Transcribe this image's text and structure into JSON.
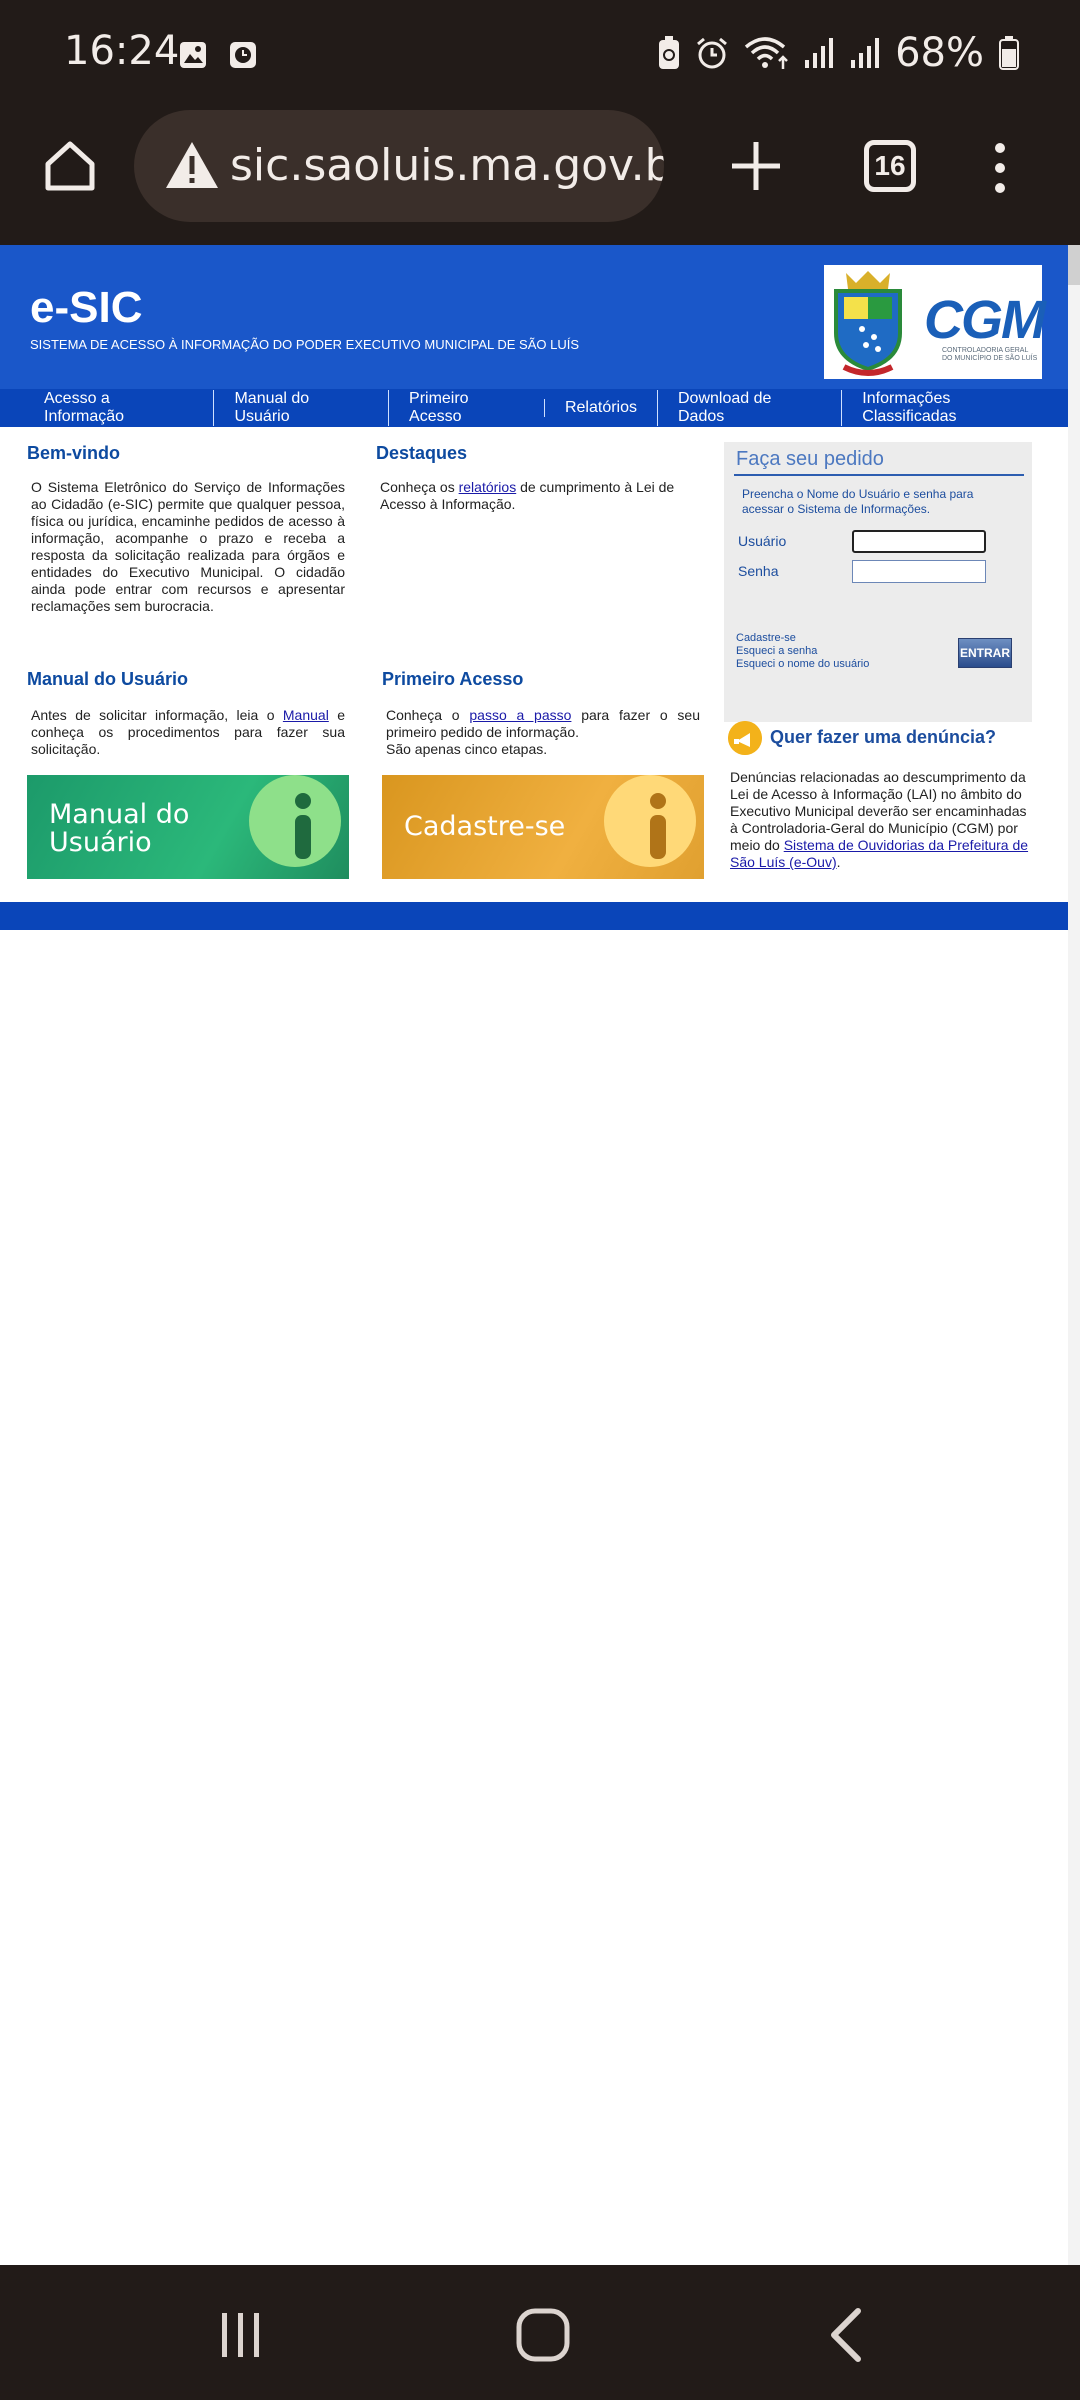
{
  "status_bar": {
    "time": "16:24",
    "battery": "68%",
    "left_icons": [
      "image-icon",
      "clock-app-icon"
    ],
    "right_icons": [
      "battery-saver-icon",
      "alarm-icon",
      "wifi-icon",
      "signal-icon",
      "signal-icon",
      "battery-icon"
    ]
  },
  "browser": {
    "url": "sic.saoluis.ma.gov.br",
    "tab_count": "16"
  },
  "site": {
    "title": "e-SIC",
    "subtitle": "SISTEMA DE ACESSO À INFORMAÇÃO DO PODER EXECUTIVO MUNICIPAL DE SÃO LUÍS",
    "logo_text": "CGM",
    "logo_subtext": "CONTROLADORIA GERAL DO MUNICÍPIO DE SÃO LUÍS",
    "nav": [
      "Acesso a Informação",
      "Manual do Usuário",
      "Primeiro Acesso",
      "Relatórios",
      "Download de Dados",
      "Informações Classificadas"
    ]
  },
  "welcome": {
    "title": "Bem-vindo",
    "text": "O Sistema Eletrônico do Serviço de Informações ao Cidadão (e-SIC) permite que qualquer pessoa, física ou jurídica, encaminhe pedidos de acesso à informação, acompanhe o prazo e receba a resposta da solicitação realizada para órgãos e entidades do Executivo Municipal. O cidadão ainda pode entrar com recursos e apresentar reclamações sem burocracia."
  },
  "highlights": {
    "title": "Destaques",
    "text_before": "Conheça os ",
    "link": "relatórios",
    "text_after": " de cumprimento à Lei de Acesso à Informação."
  },
  "manual": {
    "title": "Manual do Usuário",
    "text_before": "Antes de solicitar informação, leia o ",
    "link": "Manual",
    "text_after": " e conheça os procedimentos para fazer sua solicitação.",
    "banner_line1": "Manual do",
    "banner_line2": "Usuário"
  },
  "first_access": {
    "title": "Primeiro Acesso",
    "text_before": "Conheça o ",
    "link": "passo a passo",
    "text_after": " para fazer o seu primeiro pedido de informação.",
    "text2": "São apenas cinco etapas.",
    "banner": "Cadastre-se"
  },
  "login": {
    "title": "Faça seu pedido",
    "description": "Preencha o Nome do Usuário e senha para acessar o Sistema de Informações.",
    "user_label": "Usuário",
    "user_value": "",
    "password_label": "Senha",
    "password_value": "",
    "links": [
      "Cadastre-se",
      "Esqueci a senha",
      "Esqueci o nome do usuário"
    ],
    "submit": "ENTRAR"
  },
  "complaint": {
    "title": "Quer fazer uma denúncia?",
    "text": "Denúncias relacionadas ao descumprimento da Lei de Acesso à Informação (LAI) no âmbito do Executivo Municipal deverão ser encaminhadas à Controladoria-Geral do Município (CGM) por meio do ",
    "link": "Sistema de Ouvidorias da Prefeitura de São Luís (e-Ouv)",
    "text_end": "."
  },
  "colors": {
    "header_blue": "#1a57c9",
    "nav_blue": "#0a45b9",
    "heading_blue": "#0d4aa0",
    "system_bar": "#221b18"
  }
}
